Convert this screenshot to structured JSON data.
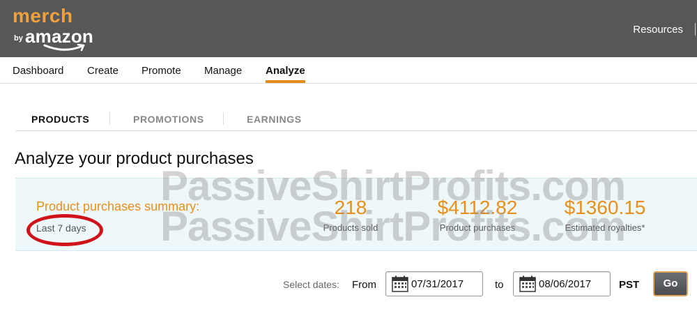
{
  "header": {
    "logo_merch": "merch",
    "logo_by": "by",
    "logo_amazon": "amazon",
    "resources_label": "Resources"
  },
  "nav": {
    "items": [
      "Dashboard",
      "Create",
      "Promote",
      "Manage",
      "Analyze"
    ],
    "active": "Analyze"
  },
  "subtabs": {
    "items": [
      "PRODUCTS",
      "PROMOTIONS",
      "EARNINGS"
    ],
    "active": "PRODUCTS"
  },
  "page_title": "Analyze your product purchases",
  "summary": {
    "title": "Product purchases summary:",
    "period": "Last 7 days",
    "stats": [
      {
        "value": "218",
        "label": "Products sold"
      },
      {
        "value": "$4112.82",
        "label": "Product purchases"
      },
      {
        "value": "$1360.15",
        "label": "Estimated royalties*"
      }
    ]
  },
  "watermark": {
    "text": "PassiveShirtProfits.com"
  },
  "date_selector": {
    "label": "Select dates:",
    "from_label": "From",
    "from_value": "07/31/2017",
    "to_label": "to",
    "to_value": "08/06/2017",
    "timezone": "PST",
    "go_label": "Go"
  },
  "icons": {
    "calendar": "calendar-icon"
  },
  "colors": {
    "header_bg": "#555759",
    "accent_orange": "#e98f1a",
    "highlight_circle": "#d0121b"
  }
}
